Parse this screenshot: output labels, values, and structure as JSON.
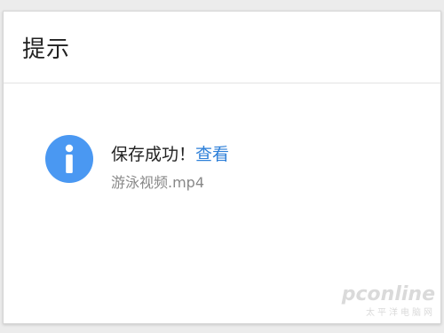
{
  "dialog": {
    "title": "提示",
    "message": "保存成功！",
    "view_link": "查看",
    "filename": "游泳视频.mp4",
    "icon": "info-icon"
  },
  "watermark": {
    "logo": "pconline",
    "subtitle": "太平洋电脑网"
  },
  "colors": {
    "icon_blue": "#4a98f2",
    "link_blue": "#2d7fd8"
  }
}
